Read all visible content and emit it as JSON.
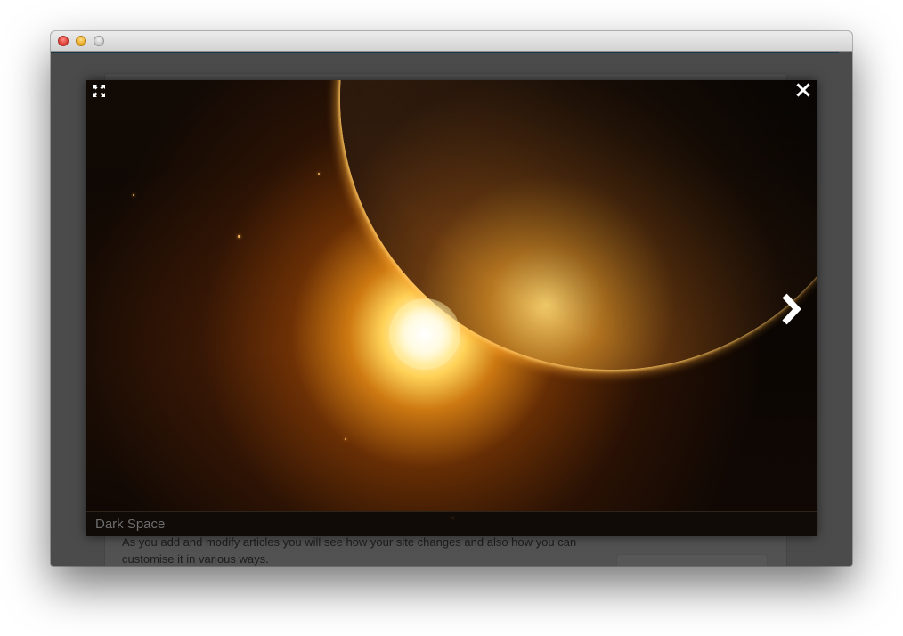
{
  "window": {
    "title_bar_buttons": [
      "close",
      "minimize",
      "zoom"
    ]
  },
  "lightbox": {
    "caption": "Dark Space",
    "icons": {
      "expand": "expand-icon",
      "close": "close-icon",
      "next": "chevron-right-icon"
    }
  },
  "article": {
    "paragraph": "As you add and modify articles you will see how your site changes and also how you can customise it in various ways."
  },
  "colors": {
    "overlay": "#4b4b4b",
    "accent_bar": "#18384a",
    "caption_text": "#6e6e6e"
  }
}
